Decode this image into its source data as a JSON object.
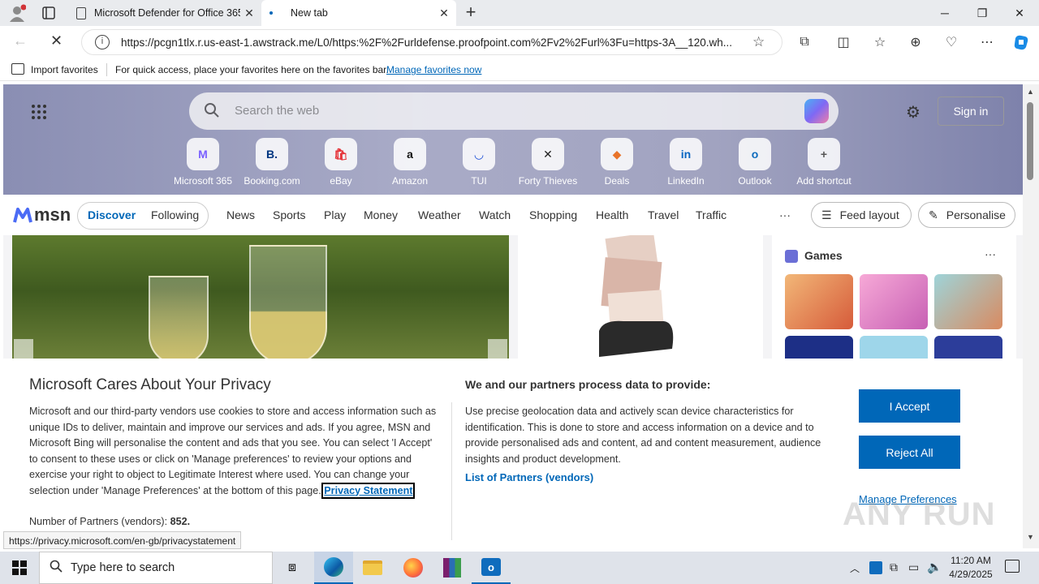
{
  "browser": {
    "tabs": [
      {
        "label": "Microsoft Defender for Office 365",
        "active": false
      },
      {
        "label": "New tab",
        "active": true
      }
    ],
    "address_url": "https://pcgn1tlx.r.us-east-1.awstrack.me/L0/https:%2F%2Furldefense.proofpoint.com%2Fv2%2Furl%3Fu=https-3A__120.wh...",
    "favbar": {
      "import_label": "Import favorites",
      "hint_text": "For quick access, place your favorites here on the favorites bar.",
      "manage_link": "Manage favorites now"
    },
    "status_url": "https://privacy.microsoft.com/en-gb/privacystatement"
  },
  "newtab": {
    "search_placeholder": "Search the web",
    "sign_in_label": "Sign in",
    "shortcuts": [
      {
        "label": "Microsoft 365",
        "icon": "M",
        "color": "#7b61ff"
      },
      {
        "label": "Booking.com",
        "icon": "B.",
        "color": "#003580"
      },
      {
        "label": "eBay",
        "icon": "🛍",
        "color": "#e53238"
      },
      {
        "label": "Amazon",
        "icon": "a",
        "color": "#111111"
      },
      {
        "label": "TUI",
        "icon": "◡",
        "color": "#1c4fd6"
      },
      {
        "label": "Forty Thieves",
        "icon": "✕",
        "color": "#222222"
      },
      {
        "label": "Deals",
        "icon": "◆",
        "color": "#e8732a"
      },
      {
        "label": "LinkedIn",
        "icon": "in",
        "color": "#0a66c2"
      },
      {
        "label": "Outlook",
        "icon": "o",
        "color": "#0f6cbd"
      },
      {
        "label": "Add shortcut",
        "icon": "+",
        "color": "#555555"
      }
    ],
    "msn_logo": "msn",
    "nav": {
      "discover": "Discover",
      "following": "Following",
      "links": [
        "News",
        "Sports",
        "Play",
        "Money",
        "Weather",
        "Watch",
        "Shopping",
        "Health",
        "Travel",
        "Traffic"
      ],
      "more": "···",
      "feed_layout": "Feed layout",
      "personalise": "Personalise"
    },
    "games_title": "Games",
    "games_more": "···"
  },
  "privacy": {
    "title": "Microsoft Cares About Your Privacy",
    "body": "Microsoft and our third-party vendors use cookies to store and access information such as unique IDs to deliver, maintain and improve our services and ads. If you agree, MSN and Microsoft Bing will personalise the content and ads that you see. You can select 'I Accept' to consent to these uses or click on 'Manage preferences' to review your options and exercise your right to object to Legitimate Interest where used.  You can change your selection under 'Manage Preferences' at the bottom of this page.",
    "privacy_link": "Privacy Statement",
    "partners_label": "Number of Partners (vendors):",
    "partners_count": "852.",
    "right_title": "We and our partners process data to provide:",
    "right_body": "Use precise geolocation data and actively scan device characteristics for identification. This is done to store and access information on a device and to provide personalised ads and content, ad and content measurement, audience insights and product development.",
    "partners_link": "List of Partners (vendors)",
    "accept": "I Accept",
    "reject": "Reject All",
    "manage": "Manage Preferences",
    "watermark": "ANY RUN"
  },
  "taskbar": {
    "search_placeholder": "Type here to search",
    "time": "11:20 AM",
    "date": "4/29/2025"
  }
}
